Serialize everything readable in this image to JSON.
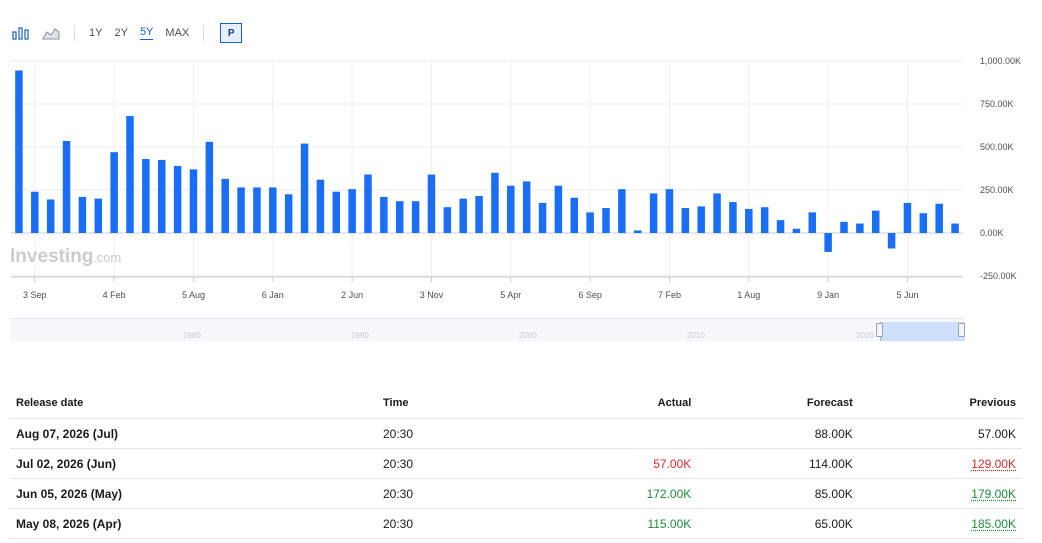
{
  "toolbar": {
    "ranges": [
      "1Y",
      "2Y",
      "5Y",
      "MAX"
    ],
    "active_range": "5Y",
    "p_label": "P"
  },
  "watermark": {
    "brand": "Investing",
    "suffix": ".com"
  },
  "navigator": {
    "labels": [
      "1980",
      "1990",
      "2000",
      "2010",
      "2020"
    ]
  },
  "colors": {
    "bar": "#1a6ef5",
    "actual_bad": "#d92b2b",
    "actual_good": "#1f8a3a"
  },
  "chart_data": {
    "type": "bar",
    "ylim": [
      -300,
      1000
    ],
    "yticks": [
      1000,
      750,
      500,
      250,
      0,
      -250
    ],
    "ytick_labels": [
      "1,000.00K",
      "750.00K",
      "500.00K",
      "250.00K",
      "0.00K",
      "-250.00K"
    ],
    "xtick_labels": [
      "3 Sep",
      "4 Feb",
      "5 Aug",
      "6 Jan",
      "2 Jun",
      "3 Nov",
      "5 Apr",
      "6 Sep",
      "7 Feb",
      "1 Aug",
      "9 Jan",
      "5 Jun"
    ],
    "xtick_bar_index": [
      1,
      6,
      11,
      16,
      21,
      26,
      31,
      36,
      41,
      46,
      51,
      56
    ],
    "grid": true,
    "values": [
      945,
      240,
      195,
      535,
      210,
      200,
      470,
      680,
      430,
      425,
      390,
      370,
      530,
      315,
      265,
      265,
      265,
      225,
      520,
      310,
      240,
      255,
      340,
      210,
      185,
      185,
      340,
      150,
      200,
      215,
      350,
      275,
      300,
      175,
      275,
      205,
      120,
      145,
      255,
      15,
      230,
      255,
      145,
      155,
      230,
      180,
      140,
      150,
      75,
      25,
      120,
      -110,
      65,
      55,
      130,
      -90,
      175,
      115,
      170,
      55
    ]
  },
  "table": {
    "headers": {
      "date": "Release date",
      "time": "Time",
      "actual": "Actual",
      "forecast": "Forecast",
      "previous": "Previous"
    },
    "rows": [
      {
        "date": "Aug 07, 2026 (Jul)",
        "time": "20:30",
        "actual": "",
        "forecast": "88.00K",
        "previous": "57.00K"
      },
      {
        "date": "Jul 02, 2026 (Jun)",
        "time": "20:30",
        "actual": "57.00K",
        "forecast": "114.00K",
        "previous": "129.00K"
      },
      {
        "date": "Jun 05, 2026 (May)",
        "time": "20:30",
        "actual": "172.00K",
        "forecast": "85.00K",
        "previous": "179.00K"
      },
      {
        "date": "May 08, 2026 (Apr)",
        "time": "20:30",
        "actual": "115.00K",
        "forecast": "65.00K",
        "previous": "185.00K"
      }
    ]
  }
}
